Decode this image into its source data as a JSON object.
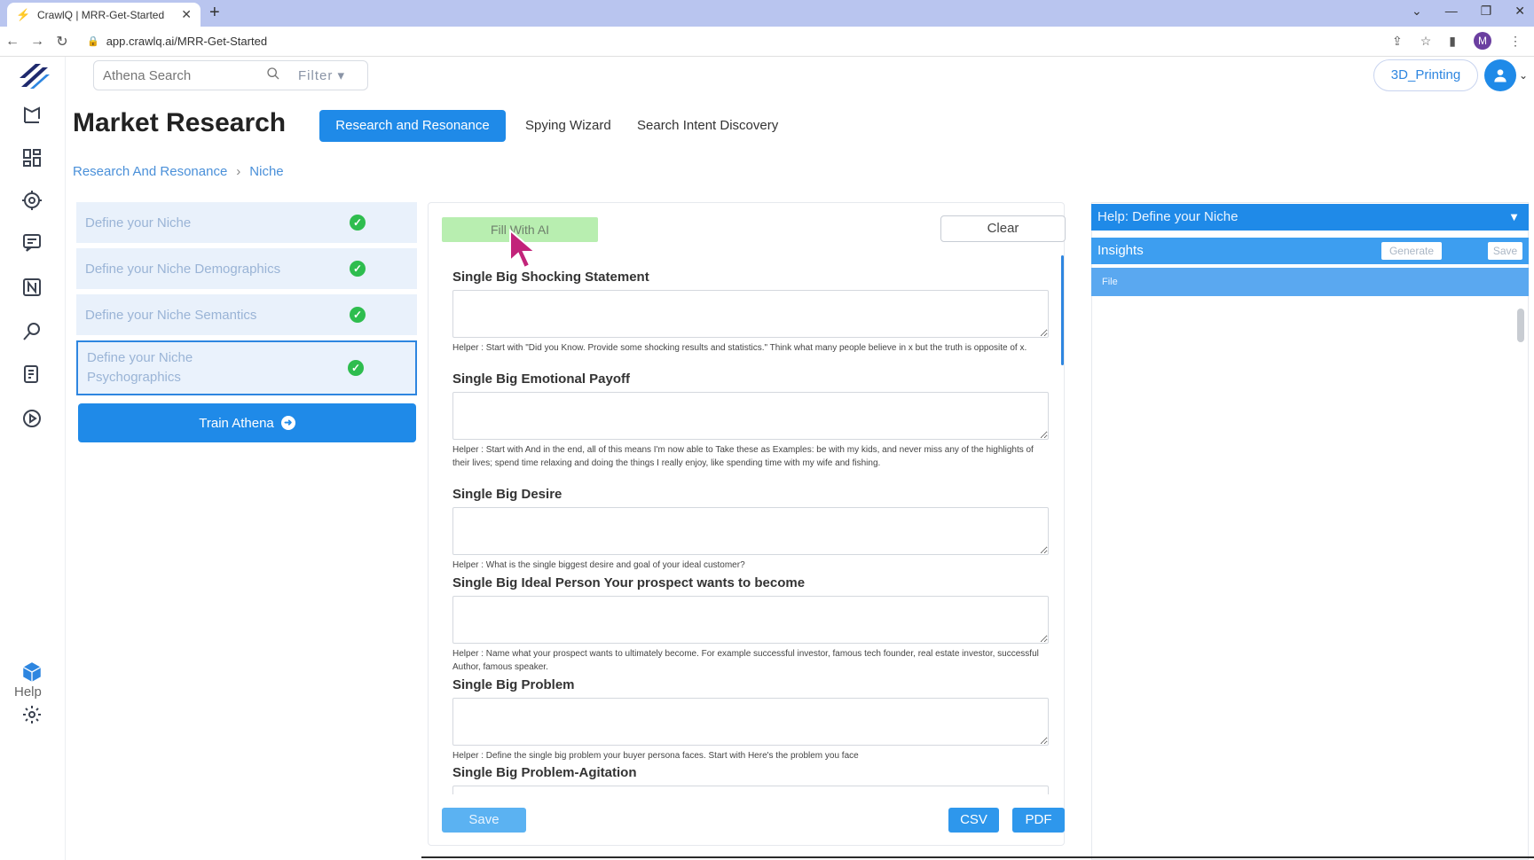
{
  "browser": {
    "tab_title": "CrawlQ | MRR-Get-Started",
    "tab_close": "✕",
    "new_tab": "+",
    "url": "app.crawlq.ai/MRR-Get-Started",
    "profile_initial": "M"
  },
  "header": {
    "search_placeholder": "Athena Search",
    "filter_label": "Filter",
    "project_label": "3D_Printing"
  },
  "page": {
    "title": "Market Research",
    "tabs": [
      {
        "label": "Research and Resonance"
      },
      {
        "label": "Spying Wizard"
      },
      {
        "label": "Search Intent Discovery"
      }
    ],
    "breadcrumb": [
      "Research And Resonance",
      "Niche"
    ]
  },
  "steps": [
    {
      "label": "Define your Niche"
    },
    {
      "label": "Define your Niche Demographics"
    },
    {
      "label": "Define your Niche Semantics"
    },
    {
      "label": "Define your Niche Psychographics"
    }
  ],
  "train_button": "Train Athena",
  "form": {
    "fill_ai_label": "Fill With AI",
    "clear_label": "Clear",
    "fields": [
      {
        "label": "Single Big Shocking Statement",
        "value": "",
        "helper": "Helper : Start with \"Did you Know. Provide some shocking results and statistics.\" Think what many people believe in x but the truth is opposite of x."
      },
      {
        "label": "Single Big Emotional Payoff",
        "value": "",
        "helper": "Helper : Start with And in the end, all of this means I'm now able to Take these as Examples: be with my kids, and never miss any of the highlights of their lives; spend time relaxing and doing the things I really enjoy, like spending time with my wife and fishing."
      },
      {
        "label": "Single Big Desire",
        "value": "",
        "helper": "Helper : What is the single biggest desire and goal of your ideal customer?"
      },
      {
        "label": "Single Big Ideal Person Your prospect wants to become",
        "value": "",
        "helper": "Helper : Name what your prospect wants to ultimately become. For example successful investor, famous tech founder, real estate investor, successful Author, famous speaker."
      },
      {
        "label": "Single Big Problem",
        "value": "",
        "helper": "Helper : Define the single big problem your buyer persona faces. Start with Here's the problem you face"
      },
      {
        "label": "Single Big Problem-Agitation",
        "value": "",
        "helper": ""
      }
    ],
    "save_label": "Save",
    "csv_label": "CSV",
    "pdf_label": "PDF"
  },
  "help_panel": {
    "title": "Help: Define your Niche",
    "insights_label": "Insights",
    "generate_label": "Generate",
    "save_label": "Save",
    "file_label": "File"
  },
  "sidebar": {
    "help_label": "Help",
    "icons": [
      "logo-icon",
      "campaign-icon",
      "dashboard-grid-icon",
      "target-icon",
      "chat-doc-icon",
      "notion-icon",
      "search-key-icon",
      "notes-icon",
      "play-icon",
      "cube-icon",
      "gear-icon"
    ]
  },
  "colors": {
    "primary": "#1f8ae8",
    "success": "#2ebd4e",
    "fill_ai": "#b8eeb0",
    "step_bg": "#e9f1fb"
  }
}
